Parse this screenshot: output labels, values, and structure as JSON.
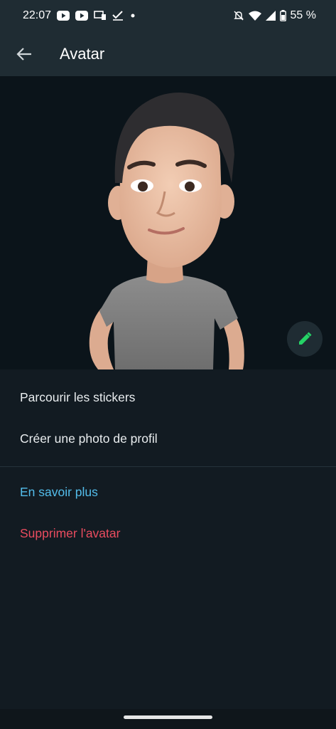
{
  "status_bar": {
    "time": "22:07",
    "left_icons": [
      "youtube-icon",
      "youtube-icon",
      "cast-icon",
      "check-icon",
      "dot-icon"
    ],
    "right_icons": [
      "bell-off-icon",
      "wifi-icon",
      "signal-icon",
      "battery-icon"
    ],
    "battery_percent": "55 %"
  },
  "app_bar": {
    "back_icon": "arrow-left-icon",
    "title": "Avatar"
  },
  "avatar_preview": {
    "edit_icon": "pencil-icon",
    "accent_color": "#25d366"
  },
  "menu": {
    "items": [
      {
        "label": "Parcourir les stickers"
      },
      {
        "label": "Créer une photo de profil"
      }
    ],
    "learn_more": "En savoir plus",
    "delete": "Supprimer l'avatar"
  },
  "colors": {
    "background": "#121b22",
    "header": "#1f2c33",
    "link": "#53bdeb",
    "danger": "#ea4c5f"
  }
}
